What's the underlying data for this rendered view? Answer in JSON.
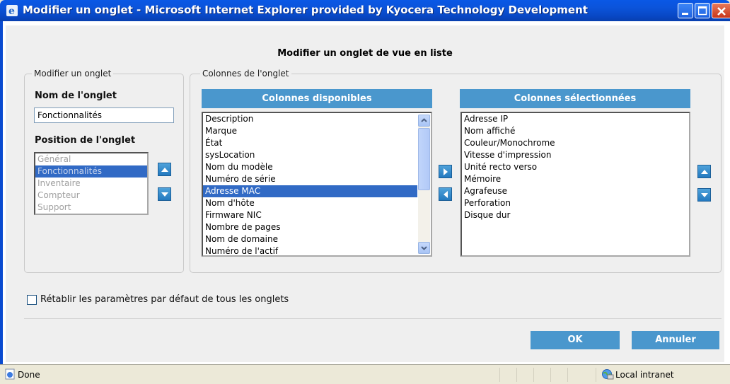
{
  "window": {
    "title": "Modifier un onglet - Microsoft Internet Explorer provided by Kyocera Technology Development"
  },
  "dialog": {
    "heading": "Modifier un onglet de vue en liste",
    "tab_group": {
      "legend": "Modifier un onglet",
      "name_label": "Nom de l'onglet",
      "name_value": "Fonctionnalités",
      "position_label": "Position de l'onglet",
      "positions": [
        "Général",
        "Fonctionnalités",
        "Inventaire",
        "Compteur",
        "Support"
      ],
      "selected_position": "Fonctionnalités"
    },
    "columns_group": {
      "legend": "Colonnes de l'onglet",
      "available_header": "Colonnes disponibles",
      "available": [
        "Description",
        "Marque",
        "État",
        "sysLocation",
        "Nom du modèle",
        "Numéro de série",
        "Adresse MAC",
        "Nom d'hôte",
        "Firmware NIC",
        "Nombre de pages",
        "Nom de domaine",
        "Numéro de l'actif"
      ],
      "available_selected": "Adresse MAC",
      "selected_header": "Colonnes sélectionnées",
      "selected": [
        "Adresse IP",
        "Nom affiché",
        "Couleur/Monochrome",
        "Vitesse d'impression",
        "Unité recto verso",
        "Mémoire",
        "Agrafeuse",
        "Perforation",
        "Disque dur"
      ]
    },
    "reset_checkbox_label": "Rétablir les paramètres par défaut de tous les onglets",
    "reset_checked": false,
    "ok_label": "OK",
    "cancel_label": "Annuler"
  },
  "statusbar": {
    "status": "Done",
    "zone": "Local intranet"
  },
  "icons": {
    "title": "ie-icon",
    "status": "ie-page-icon",
    "zone": "intranet-globe-icon"
  },
  "colors": {
    "accent": "#4a97cd",
    "selection": "#316ac5",
    "titlebar": "#0a58e6"
  }
}
